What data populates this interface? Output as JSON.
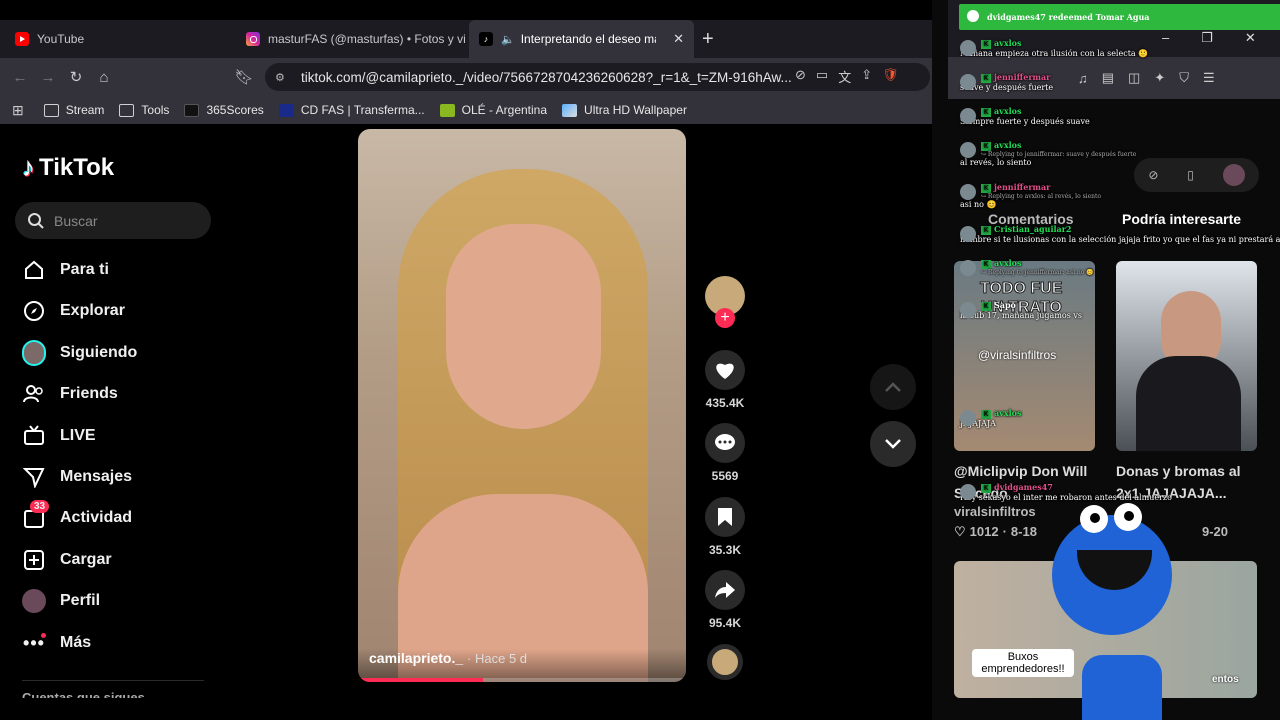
{
  "tabs": [
    {
      "label": "YouTube",
      "icon": "youtube-icon",
      "color": "#ff0000"
    },
    {
      "label": "masturFAS (@masturfas) • Fotos y vid",
      "icon": "instagram-icon",
      "color": "#d6249f"
    },
    {
      "label": "Interpretando el deseo mascu",
      "icon": "tiktok-icon",
      "color": "#000000"
    }
  ],
  "address": "tiktok.com/@camilaprieto._/video/7566728704236260628?_r=1&_t=ZM-916hAw...",
  "bookmarks": [
    "Stream",
    "Tools",
    "365Scores",
    "CD FAS | Transferma...",
    "OLÉ - Argentina",
    "Ultra HD Wallpaper"
  ],
  "tiktok": {
    "logo": "TikTok",
    "search_placeholder": "Buscar",
    "nav": [
      "Para ti",
      "Explorar",
      "Siguiendo",
      "Friends",
      "LIVE",
      "Mensajes",
      "Actividad",
      "Cargar",
      "Perfil",
      "Más"
    ],
    "activity_badge": "33",
    "footer_hint": "Cuentas que sigues",
    "video": {
      "author": "camilaprieto._",
      "time": "· Hace 5 d",
      "progress": 0.38
    },
    "counts": {
      "likes": "435.4K",
      "comments": "5569",
      "saves": "35.3K",
      "shares": "95.4K"
    },
    "side_tabs": {
      "comments": "Comentarios",
      "related": "Podría interesarte"
    },
    "cards": [
      {
        "title": "@Miclipvip Don Will Salcedo",
        "author": "viralsinfiltros",
        "likes": "1012",
        "date": "8-18",
        "overlay": [
          "TODO FUE",
          "UN TRATO"
        ],
        "watermark": "@viralsinfiltros"
      },
      {
        "title": "Donas y bromas al 2x1 JAJAJAJA...",
        "date": "9-20"
      },
      {
        "overlay": [
          "Buxos",
          "emprendedores!!"
        ],
        "corner": "entos"
      }
    ]
  },
  "stream_overlay": {
    "redeem": "dvidgames47 redeemed Tomar Agua",
    "chat": [
      {
        "user": "avxlos",
        "color": "#22dd55",
        "msg": "Mañana empieza otra ilusión con la selecta 🙂"
      },
      {
        "user": "jenniffermar",
        "color": "#e0508a",
        "msg": "suave y después fuerte"
      },
      {
        "user": "avxlos",
        "color": "#22dd55",
        "msg": "Siempre fuerte y después suave"
      },
      {
        "user": "avxlos",
        "color": "#22dd55",
        "reply": "↪ Replying to jenniffermar: suave y después fuerte",
        "msg": "al revés, lo siento"
      },
      {
        "user": "jenniffermar",
        "color": "#e0508a",
        "reply": "↪ Replying to avxlos: al revés, lo siento",
        "msg": "asi no 😊"
      },
      {
        "user": "Cristian_aguilar2",
        "color": "#22dd55",
        "msg": "nombre si te ilusionas con la selección jajaja frito yo que el fas ya ni prestará a Tejada"
      },
      {
        "user": "avxlos",
        "color": "#22dd55",
        "reply": "↪ Replying to jenniffermar: asi no 😊",
        "msg": ""
      },
      {
        "user": "Sapo",
        "color": "#ffffff",
        "msg": "la sub 17, mañana jugamos vs"
      },
      {
        "user": "avxlos",
        "color": "#22dd55",
        "msg": "JAJAJAJA"
      },
      {
        "user": "dvidgames47",
        "color": "#e0508a",
        "msg": "Hey sekasyo el inter me robaron antes del almuerzo"
      }
    ]
  },
  "colors": {
    "accent": "#fe2c55",
    "tabbar": "#1c1b22",
    "toolbar": "#33323a",
    "green": "#2eb83e"
  }
}
